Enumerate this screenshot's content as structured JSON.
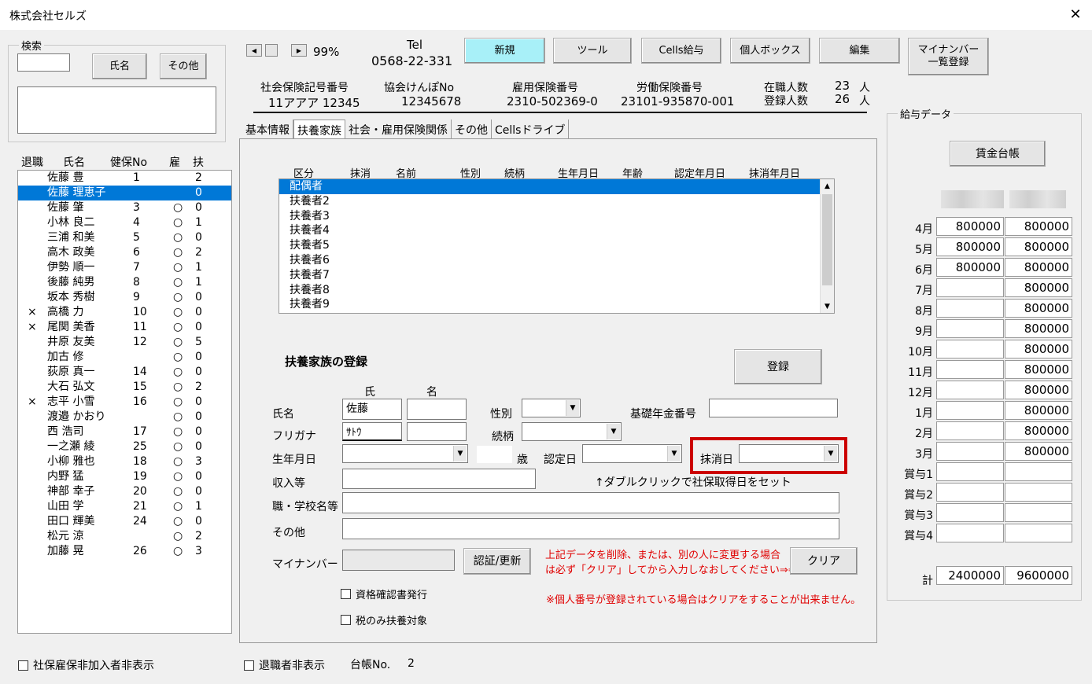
{
  "window": {
    "title": "株式会社セルズ",
    "close_glyph": "✕"
  },
  "search": {
    "group_label": "検索",
    "name_btn": "氏名",
    "other_btn": "その他",
    "input_value": ""
  },
  "zoom": {
    "left_glyph": "◀",
    "right_glyph": "▶",
    "value": "99%"
  },
  "company": {
    "tel_label": "Tel",
    "tel": "0568-22-331"
  },
  "toolbar": {
    "new": "新規",
    "tool": "ツール",
    "cells_pay": "Cells給与",
    "personal_box": "個人ボックス",
    "edit": "編集",
    "mynumber_line1": "マイナンバー",
    "mynumber_line2": "一覧登録"
  },
  "insurance": {
    "social_label": "社会保険記号番号",
    "social_value": "11アアア 12345",
    "kenpo_label": "協会けんぽNo",
    "kenpo_value": "12345678",
    "employment_label": "雇用保険番号",
    "employment_value": "2310-502369-0",
    "labor_label": "労働保険番号",
    "labor_value": "23101-935870-001",
    "active_label": "在職人数",
    "active_value": "23",
    "active_unit": "人",
    "registered_label": "登録人数",
    "registered_value": "26",
    "registered_unit": "人"
  },
  "employee_list": {
    "headers": {
      "retired": "退職",
      "name": "氏名",
      "kenpo": "健保No",
      "employ": "雇",
      "dep": "扶"
    },
    "rows": [
      {
        "mark": "",
        "name": "佐藤 豊",
        "no": "1",
        "emp": "",
        "dep": "2"
      },
      {
        "mark": "",
        "name": "佐藤 理恵子",
        "no": "",
        "emp": "",
        "dep": "0"
      },
      {
        "mark": "",
        "name": "佐藤 肇",
        "no": "3",
        "emp": "○",
        "dep": "0"
      },
      {
        "mark": "",
        "name": "小林 良二",
        "no": "4",
        "emp": "○",
        "dep": "1"
      },
      {
        "mark": "",
        "name": "三浦 和美",
        "no": "5",
        "emp": "○",
        "dep": "0"
      },
      {
        "mark": "",
        "name": "高木 政美",
        "no": "6",
        "emp": "○",
        "dep": "2"
      },
      {
        "mark": "",
        "name": "伊勢 順一",
        "no": "7",
        "emp": "○",
        "dep": "1"
      },
      {
        "mark": "",
        "name": "後藤 純男",
        "no": "8",
        "emp": "○",
        "dep": "1"
      },
      {
        "mark": "",
        "name": "坂本 秀樹",
        "no": "9",
        "emp": "○",
        "dep": "0"
      },
      {
        "mark": "×",
        "name": "高橋 力",
        "no": "10",
        "emp": "○",
        "dep": "0"
      },
      {
        "mark": "×",
        "name": "尾関 美香",
        "no": "11",
        "emp": "○",
        "dep": "0"
      },
      {
        "mark": "",
        "name": "井原 友美",
        "no": "12",
        "emp": "○",
        "dep": "5"
      },
      {
        "mark": "",
        "name": "加古 修",
        "no": "",
        "emp": "○",
        "dep": "0"
      },
      {
        "mark": "",
        "name": "荻原 真一",
        "no": "14",
        "emp": "○",
        "dep": "0"
      },
      {
        "mark": "",
        "name": "大石 弘文",
        "no": "15",
        "emp": "○",
        "dep": "2"
      },
      {
        "mark": "×",
        "name": "志平 小雪",
        "no": "16",
        "emp": "○",
        "dep": "0"
      },
      {
        "mark": "",
        "name": "渡邉 かおり",
        "no": "",
        "emp": "○",
        "dep": "0"
      },
      {
        "mark": "",
        "name": "西 浩司",
        "no": "17",
        "emp": "○",
        "dep": "0"
      },
      {
        "mark": "",
        "name": "一之瀬 綾",
        "no": "25",
        "emp": "○",
        "dep": "0"
      },
      {
        "mark": "",
        "name": "小柳 雅也",
        "no": "18",
        "emp": "○",
        "dep": "3"
      },
      {
        "mark": "",
        "name": "内野 猛",
        "no": "19",
        "emp": "○",
        "dep": "0"
      },
      {
        "mark": "",
        "name": "神部 幸子",
        "no": "20",
        "emp": "○",
        "dep": "0"
      },
      {
        "mark": "",
        "name": "山田 学",
        "no": "21",
        "emp": "○",
        "dep": "1"
      },
      {
        "mark": "",
        "name": "田口 輝美",
        "no": "24",
        "emp": "○",
        "dep": "0"
      },
      {
        "mark": "",
        "name": "松元 涼",
        "no": "",
        "emp": "○",
        "dep": "2"
      },
      {
        "mark": "",
        "name": "加藤 晃",
        "no": "26",
        "emp": "○",
        "dep": "3"
      }
    ]
  },
  "tabs": [
    "基本情報",
    "扶養家族",
    "社会・雇用保険関係",
    "その他",
    "Cellsドライブ"
  ],
  "dependents": {
    "headers": [
      "区分",
      "抹消",
      "名前",
      "性別",
      "続柄",
      "生年月日",
      "年齢",
      "認定年月日",
      "抹消年月日"
    ],
    "items": [
      "配偶者",
      "扶養者2",
      "扶養者3",
      "扶養者4",
      "扶養者5",
      "扶養者6",
      "扶養者7",
      "扶養者8",
      "扶養者9"
    ]
  },
  "form": {
    "section_title": "扶養家族の登録",
    "register_btn": "登録",
    "surname_header": "氏",
    "given_header": "名",
    "name_label": "氏名",
    "surname_value": "佐藤",
    "given_value": "",
    "kana_label": "フリガナ",
    "kana_surname": "ｻﾄｳ",
    "kana_given": "",
    "gender_label": "性別",
    "relation_label": "続柄",
    "pension_label": "基礎年金番号",
    "birth_label": "生年月日",
    "age_unit": "歳",
    "cert_label": "認定日",
    "delete_label": "抹消日",
    "income_label": "収入等",
    "hint": "↑ダブルクリックで社保取得日をセット",
    "school_label": "職・学校名等",
    "other_label": "その他",
    "mynumber_label": "マイナンバー",
    "auth_btn": "認証/更新",
    "warn1": "上記データを削除、または、別の人に変更する場合",
    "warn2": "は必ず「クリア」してから入力しなおしてください⇒⇒",
    "clear_btn": "クリア",
    "chk_cert": "資格確認書発行",
    "chk_tax": "税のみ扶養対象",
    "note": "※個人番号が登録されている場合はクリアをすることが出来ません。"
  },
  "salary": {
    "group_label": "給与データ",
    "ledger_btn": "賃金台帳",
    "rows": [
      {
        "month": "4月",
        "a": "800000",
        "b": "800000"
      },
      {
        "month": "5月",
        "a": "800000",
        "b": "800000"
      },
      {
        "month": "6月",
        "a": "800000",
        "b": "800000"
      },
      {
        "month": "7月",
        "a": "",
        "b": "800000"
      },
      {
        "month": "8月",
        "a": "",
        "b": "800000"
      },
      {
        "month": "9月",
        "a": "",
        "b": "800000"
      },
      {
        "month": "10月",
        "a": "",
        "b": "800000"
      },
      {
        "month": "11月",
        "a": "",
        "b": "800000"
      },
      {
        "month": "12月",
        "a": "",
        "b": "800000"
      },
      {
        "month": "1月",
        "a": "",
        "b": "800000"
      },
      {
        "month": "2月",
        "a": "",
        "b": "800000"
      },
      {
        "month": "3月",
        "a": "",
        "b": "800000"
      },
      {
        "month": "賞与1",
        "a": "",
        "b": ""
      },
      {
        "month": "賞与2",
        "a": "",
        "b": ""
      },
      {
        "month": "賞与3",
        "a": "",
        "b": ""
      },
      {
        "month": "賞与4",
        "a": "",
        "b": ""
      }
    ],
    "total_label": "計",
    "total_a": "2400000",
    "total_b": "9600000"
  },
  "footer": {
    "hide_uninsured": "社保雇保非加入者非表示",
    "hide_retired": "退職者非表示",
    "ledger_no_label": "台帳No.",
    "ledger_no": "2"
  },
  "arrow_glyph": "▼",
  "up_glyph": "▲"
}
